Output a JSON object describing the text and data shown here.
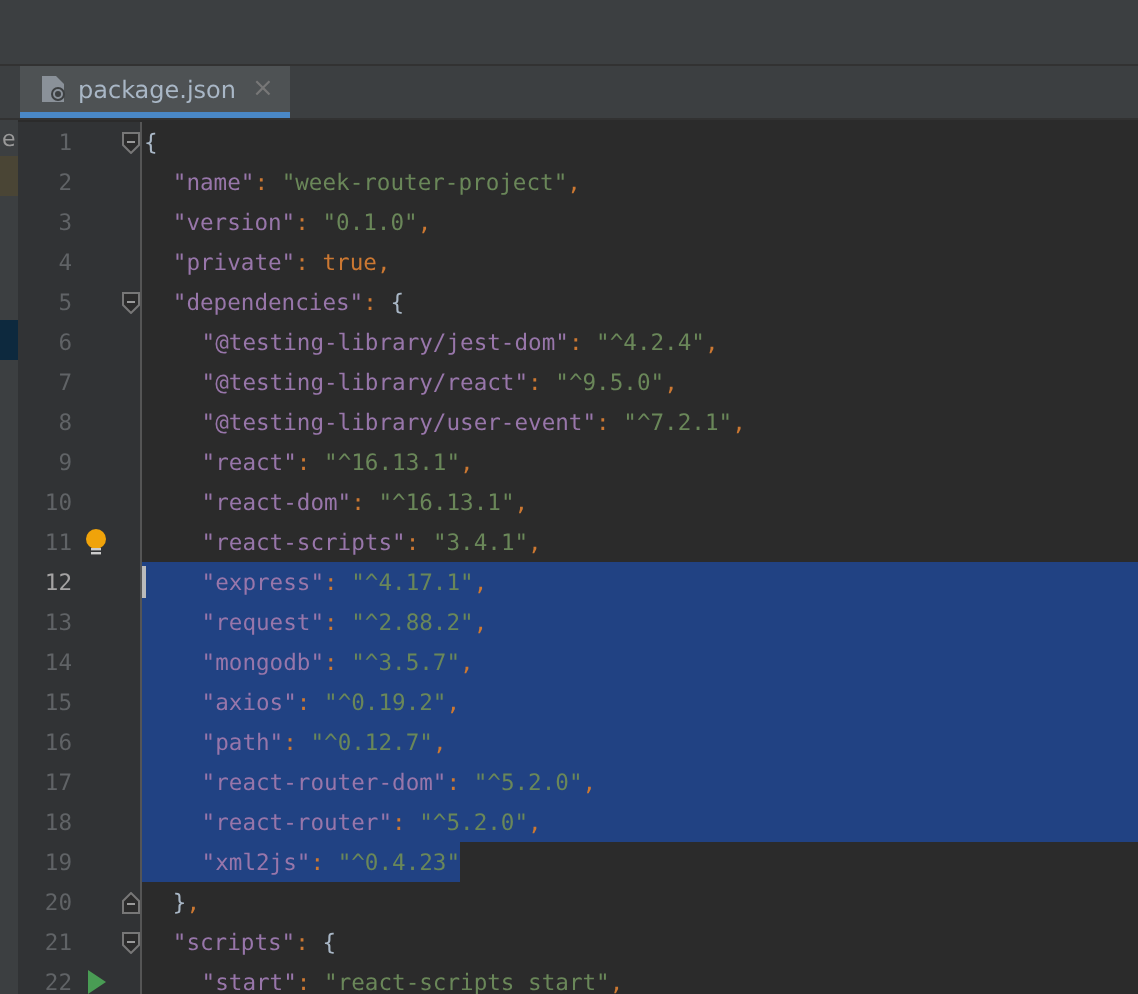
{
  "sidebar": {
    "fragment": "e"
  },
  "tabs": [
    {
      "label": "package.json",
      "selected": true,
      "close": "×"
    }
  ],
  "lines": [
    {
      "number": "1",
      "fold_start": true,
      "tokens": [
        {
          "kind": "brace",
          "text": "{"
        }
      ],
      "children": [
        {
          "number": "2",
          "tokens": [
            {
              "kind": "key",
              "text": "\"name\""
            },
            {
              "kind": "punct",
              "text": ": "
            },
            {
              "kind": "string",
              "text": "\"week-router-project\""
            },
            {
              "kind": "punct",
              "text": ","
            }
          ]
        },
        {
          "number": "3",
          "tokens": [
            {
              "kind": "key",
              "text": "\"version\""
            },
            {
              "kind": "punct",
              "text": ": "
            },
            {
              "kind": "string",
              "text": "\"0.1.0\""
            },
            {
              "kind": "punct",
              "text": ","
            }
          ]
        },
        {
          "number": "4",
          "tokens": [
            {
              "kind": "key",
              "text": "\"private\""
            },
            {
              "kind": "punct",
              "text": ": "
            },
            {
              "kind": "keyword",
              "text": "true"
            },
            {
              "kind": "punct",
              "text": ","
            }
          ]
        },
        {
          "number": "5",
          "fold_start": true,
          "tokens": [
            {
              "kind": "key",
              "text": "\"dependencies\""
            },
            {
              "kind": "punct",
              "text": ": "
            },
            {
              "kind": "brace",
              "text": "{"
            }
          ],
          "children": [
            {
              "number": "6",
              "tokens": [
                {
                  "kind": "key",
                  "text": "\"@testing-library/jest-dom\""
                },
                {
                  "kind": "punct",
                  "text": ": "
                },
                {
                  "kind": "string",
                  "text": "\"^4.2.4\""
                },
                {
                  "kind": "punct",
                  "text": ","
                }
              ]
            },
            {
              "number": "7",
              "tokens": [
                {
                  "kind": "key",
                  "text": "\"@testing-library/react\""
                },
                {
                  "kind": "punct",
                  "text": ": "
                },
                {
                  "kind": "string",
                  "text": "\"^9.5.0\""
                },
                {
                  "kind": "punct",
                  "text": ","
                }
              ]
            },
            {
              "number": "8",
              "tokens": [
                {
                  "kind": "key",
                  "text": "\"@testing-library/user-event\""
                },
                {
                  "kind": "punct",
                  "text": ": "
                },
                {
                  "kind": "string",
                  "text": "\"^7.2.1\""
                },
                {
                  "kind": "punct",
                  "text": ","
                }
              ]
            },
            {
              "number": "9",
              "tokens": [
                {
                  "kind": "key",
                  "text": "\"react\""
                },
                {
                  "kind": "punct",
                  "text": ": "
                },
                {
                  "kind": "string",
                  "text": "\"^16.13.1\""
                },
                {
                  "kind": "punct",
                  "text": ","
                }
              ]
            },
            {
              "number": "10",
              "tokens": [
                {
                  "kind": "key",
                  "text": "\"react-dom\""
                },
                {
                  "kind": "punct",
                  "text": ": "
                },
                {
                  "kind": "string",
                  "text": "\"^16.13.1\""
                },
                {
                  "kind": "punct",
                  "text": ","
                }
              ]
            },
            {
              "number": "11",
              "intention": true,
              "tokens": [
                {
                  "kind": "key",
                  "text": "\"react-scripts\""
                },
                {
                  "kind": "punct",
                  "text": ": "
                },
                {
                  "kind": "string",
                  "text": "\"3.4.1\""
                },
                {
                  "kind": "punct",
                  "text": ","
                }
              ]
            },
            {
              "number": "12",
              "selected": true,
              "caret": true,
              "tokens": [
                {
                  "kind": "key",
                  "text": "\"express\""
                },
                {
                  "kind": "punct",
                  "text": ": "
                },
                {
                  "kind": "string",
                  "text": "\"^4.17.1\""
                },
                {
                  "kind": "punct",
                  "text": ","
                }
              ]
            },
            {
              "number": "13",
              "selected": true,
              "tokens": [
                {
                  "kind": "key",
                  "text": "\"request\""
                },
                {
                  "kind": "punct",
                  "text": ": "
                },
                {
                  "kind": "string",
                  "text": "\"^2.88.2\""
                },
                {
                  "kind": "punct",
                  "text": ","
                }
              ]
            },
            {
              "number": "14",
              "selected": true,
              "tokens": [
                {
                  "kind": "key",
                  "text": "\"mongodb\""
                },
                {
                  "kind": "punct",
                  "text": ": "
                },
                {
                  "kind": "string",
                  "text": "\"^3.5.7\""
                },
                {
                  "kind": "punct",
                  "text": ","
                }
              ]
            },
            {
              "number": "15",
              "selected": true,
              "tokens": [
                {
                  "kind": "key",
                  "text": "\"axios\""
                },
                {
                  "kind": "punct",
                  "text": ": "
                },
                {
                  "kind": "string",
                  "text": "\"^0.19.2\""
                },
                {
                  "kind": "punct",
                  "text": ","
                }
              ]
            },
            {
              "number": "16",
              "selected": true,
              "tokens": [
                {
                  "kind": "key",
                  "text": "\"path\""
                },
                {
                  "kind": "punct",
                  "text": ": "
                },
                {
                  "kind": "string",
                  "text": "\"^0.12.7\""
                },
                {
                  "kind": "punct",
                  "text": ","
                }
              ]
            },
            {
              "number": "17",
              "selected": true,
              "tokens": [
                {
                  "kind": "key",
                  "text": "\"react-router-dom\""
                },
                {
                  "kind": "punct",
                  "text": ": "
                },
                {
                  "kind": "string",
                  "text": "\"^5.2.0\""
                },
                {
                  "kind": "punct",
                  "text": ","
                }
              ]
            },
            {
              "number": "18",
              "selected": true,
              "tokens": [
                {
                  "kind": "key",
                  "text": "\"react-router\""
                },
                {
                  "kind": "punct",
                  "text": ": "
                },
                {
                  "kind": "string",
                  "text": "\"^5.2.0\""
                },
                {
                  "kind": "punct",
                  "text": ","
                }
              ]
            },
            {
              "number": "19",
              "selected": true,
              "tokens": [
                {
                  "kind": "key",
                  "text": "\"xml2js\""
                },
                {
                  "kind": "punct",
                  "text": ": "
                },
                {
                  "kind": "string",
                  "text": "\"^0.4.23\""
                }
              ]
            }
          ]
        },
        {
          "number": "20",
          "fold_end": true,
          "tokens": [
            {
              "kind": "brace",
              "text": "}"
            },
            {
              "kind": "punct",
              "text": ","
            }
          ]
        },
        {
          "number": "21",
          "fold_start": true,
          "tokens": [
            {
              "kind": "key",
              "text": "\"scripts\""
            },
            {
              "kind": "punct",
              "text": ": "
            },
            {
              "kind": "brace",
              "text": "{"
            }
          ],
          "children": [
            {
              "number": "22",
              "runnable": true,
              "tokens": [
                {
                  "kind": "key",
                  "text": "\"start\""
                },
                {
                  "kind": "punct",
                  "text": ": "
                },
                {
                  "kind": "string",
                  "text": "\"react-scripts start\""
                },
                {
                  "kind": "punct",
                  "text": ","
                }
              ]
            }
          ]
        }
      ]
    }
  ]
}
